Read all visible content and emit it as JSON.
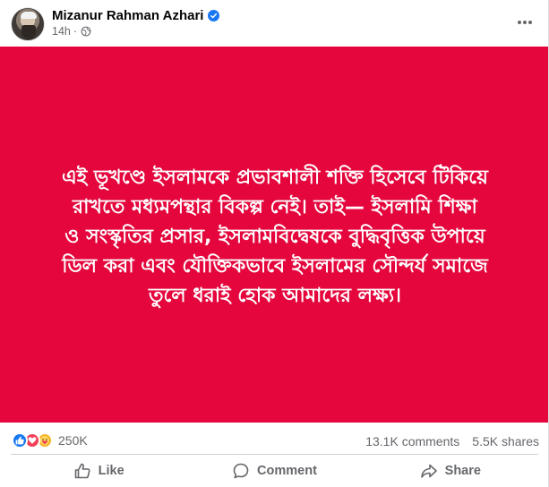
{
  "post": {
    "author": "Mizanur Rahman Azhari",
    "time": "14h",
    "icons": {
      "verified": "verified-badge-icon",
      "privacy": "globe-icon",
      "menu": "more-options-icon"
    },
    "colors": {
      "media_background": "#e4063c",
      "text": "#ffffff",
      "link": "#1877f2"
    },
    "image_text_lines": [
      "এই ভূখণ্ডে ইসলামকে প্রভাবশালী শক্তি হিসেবে টিকিয়ে",
      "রাখতে মধ্যমপন্থার বিকল্প নেই। তাই— ইসলামি শিক্ষা",
      "ও সংস্কৃতির প্রসার, ইসলামবিদ্বেষকে বুদ্ধিবৃত্তিক উপায়ে",
      "ডিল করা এবং যৌক্তিকভাবে ইসলামের সৌন্দর্য সমাজে",
      "তুলে ধরাই হোক আমাদের লক্ষ্য।"
    ]
  },
  "stats": {
    "reactions": [
      "like",
      "love",
      "care"
    ],
    "reaction_count": "250K",
    "comments": "13.1K comments",
    "shares": "5.5K shares"
  },
  "actions": {
    "like": "Like",
    "comment": "Comment",
    "share": "Share"
  }
}
